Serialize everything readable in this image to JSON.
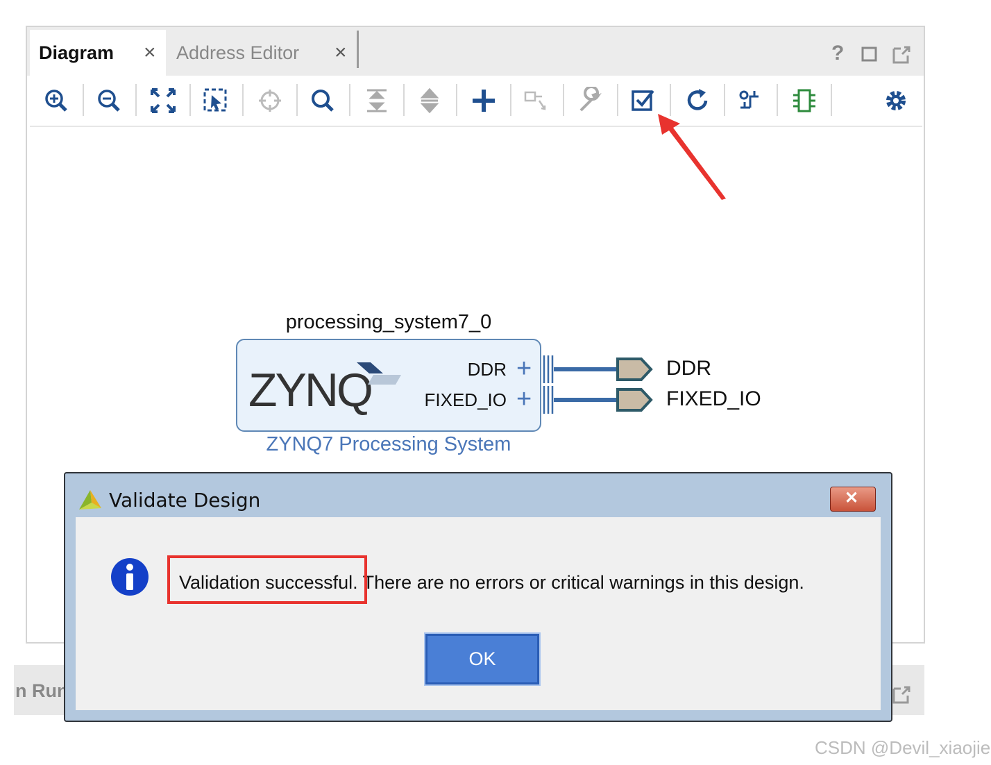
{
  "tabs": [
    {
      "label": "Diagram",
      "close": "×",
      "active": true
    },
    {
      "label": "Address Editor",
      "close": "×",
      "active": false
    }
  ],
  "window_controls": {
    "help": "?",
    "maximize": "□"
  },
  "toolbar": {
    "icons": [
      "zoom-in-icon",
      "zoom-out-icon",
      "fit-view-icon",
      "zoom-select-icon",
      "crosshair-icon",
      "search-icon",
      "collapse-icon",
      "expand-icon",
      "add-ip-icon",
      "make-connection-icon",
      "wrench-icon",
      "validate-icon",
      "refresh-icon",
      "regenerate-layout-icon",
      "add-module-icon",
      "gear-icon"
    ]
  },
  "diagram": {
    "block_name": "processing_system7_0",
    "block_logo": "ZYNQ",
    "block_subtitle": "ZYNQ7 Processing System",
    "ports": [
      {
        "label": "DDR",
        "expand": "+",
        "external": "DDR"
      },
      {
        "label": "FIXED_IO",
        "expand": "+",
        "external": "FIXED_IO"
      }
    ]
  },
  "dialog": {
    "title": "Validate Design",
    "close": "✕",
    "message_highlight": "Validation successful.",
    "message_rest": " There are no errors or critical warnings in this design.",
    "ok_label": "OK"
  },
  "background_panel": {
    "label": "n Run"
  },
  "watermark": "CSDN @Devil_xiaojie",
  "colors": {
    "accent": "#4a7fd6",
    "highlight": "#e8332e",
    "block_border": "#5f88b5",
    "port_fill": "#c9bba6"
  }
}
